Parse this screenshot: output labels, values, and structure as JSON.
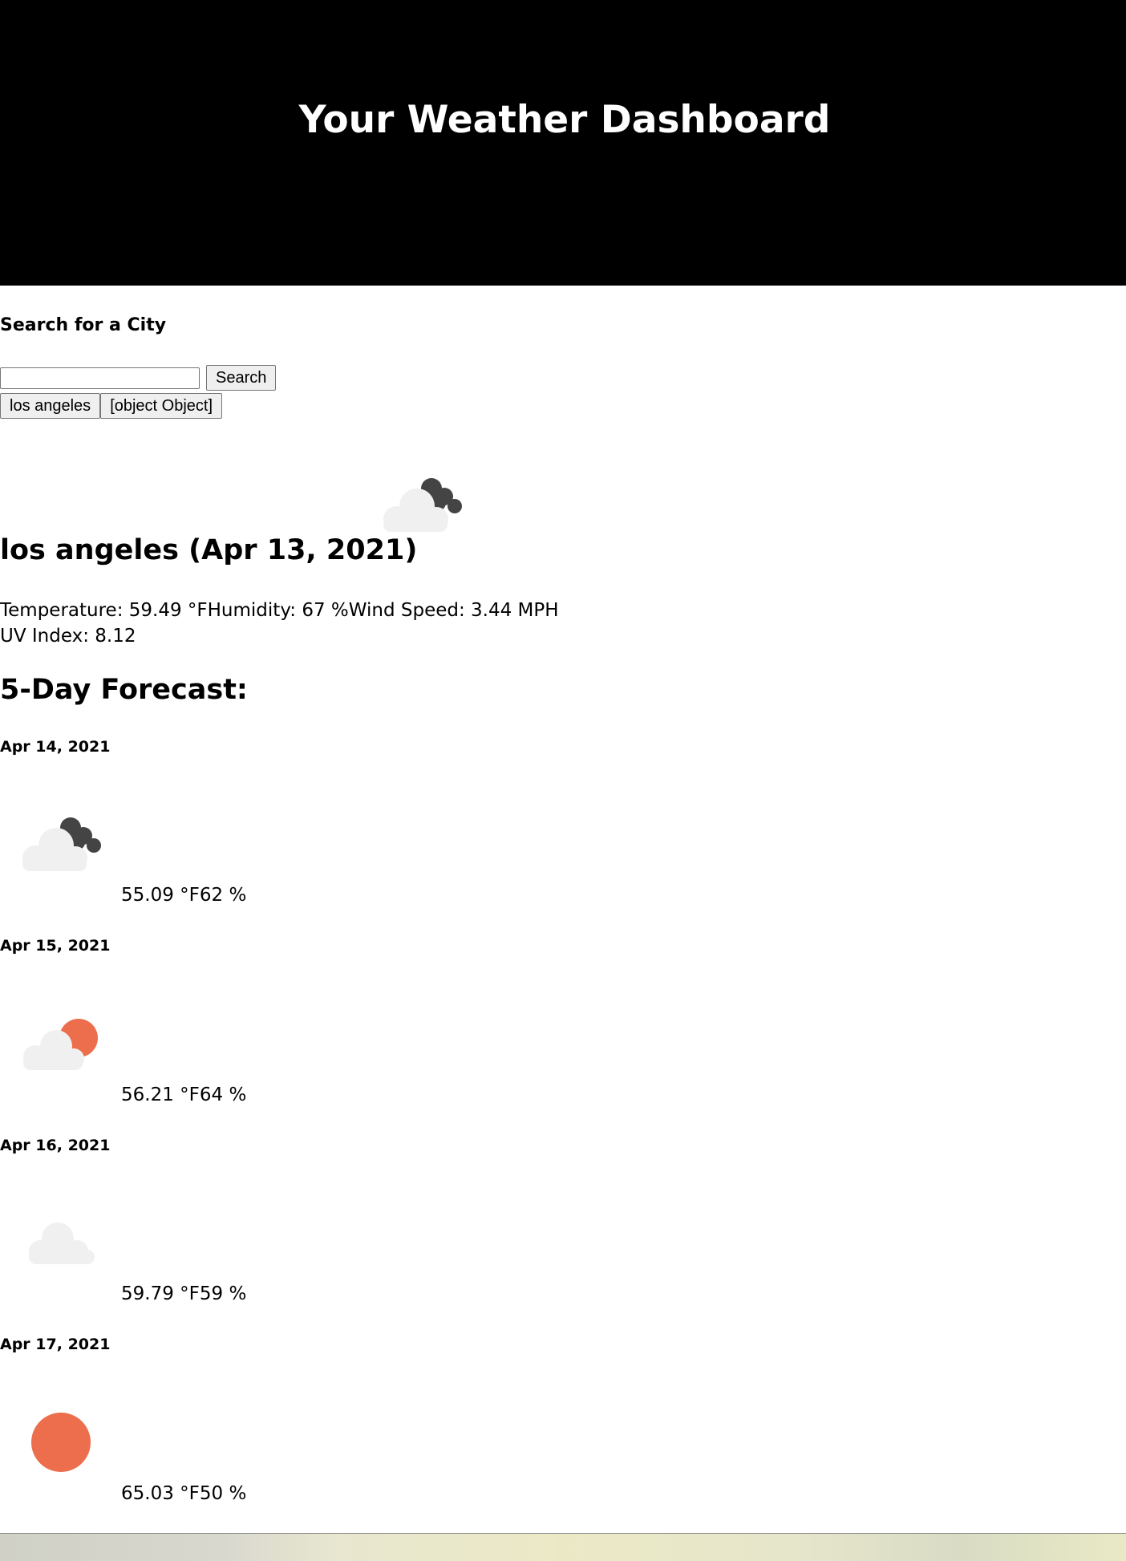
{
  "header": {
    "title": "Your Weather Dashboard"
  },
  "search": {
    "heading": "Search for a City",
    "input_value": "",
    "button_label": "Search",
    "history": [
      "los angeles",
      "[object Object]"
    ]
  },
  "current": {
    "icon": "cloudy-dark-icon",
    "title": "los angeles (Apr 13, 2021)",
    "temperature": "Temperature: 59.49 °F",
    "humidity": "Humidity: 67 %",
    "wind": "Wind Speed: 3.44 MPH",
    "uv": "UV Index: 8.12"
  },
  "forecast": {
    "title": "5-Day Forecast:",
    "days": [
      {
        "date": "Apr 14, 2021",
        "icon": "dark-clouds-icon",
        "temp": "55.09 °F",
        "humidity": "62 %"
      },
      {
        "date": "Apr 15, 2021",
        "icon": "partly-sunny-icon",
        "temp": "56.21 °F",
        "humidity": "64 %"
      },
      {
        "date": "Apr 16, 2021",
        "icon": "cloud-icon",
        "temp": "59.79 °F",
        "humidity": "59 %"
      },
      {
        "date": "Apr 17, 2021",
        "icon": "sun-icon",
        "temp": "65.03 °F",
        "humidity": "50 %"
      }
    ]
  },
  "colors": {
    "header_bg": "#000000",
    "sun": "#ec6e4c",
    "dark_cloud": "#444444",
    "light_cloud": "#f0f0f0"
  }
}
